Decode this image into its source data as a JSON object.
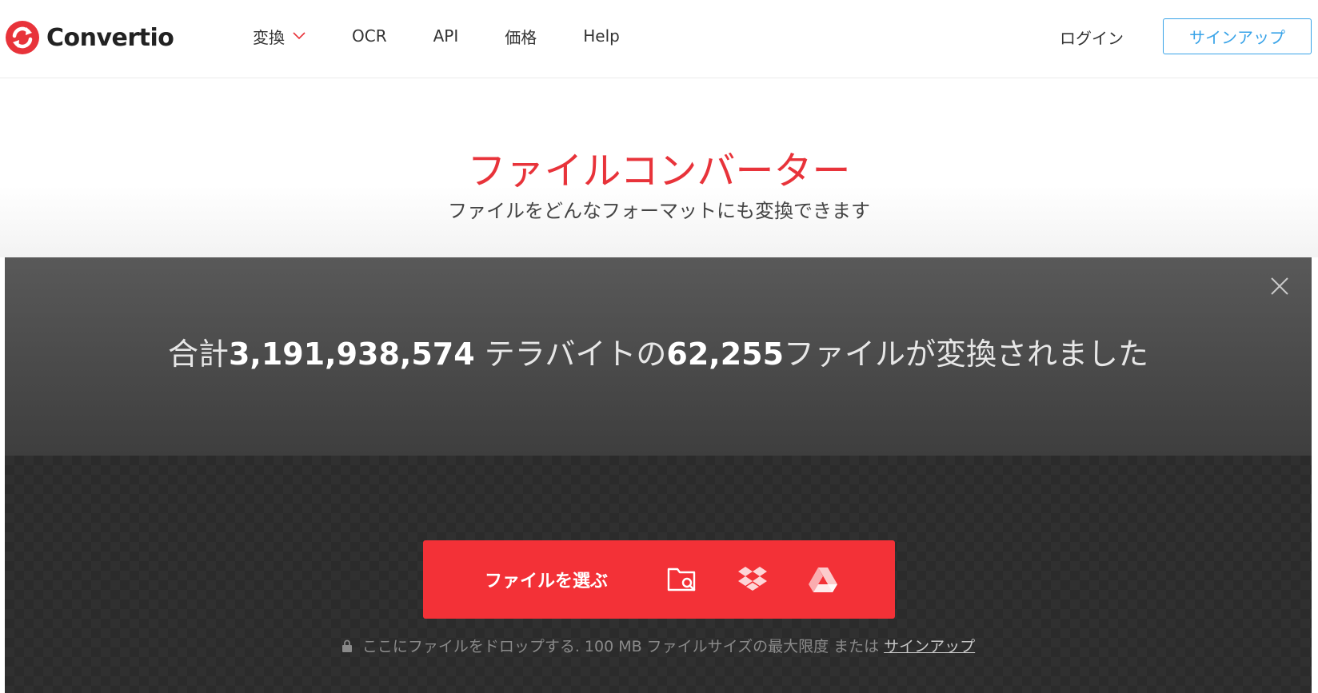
{
  "brand": {
    "name": "Convertio",
    "accent": "#e8333a"
  },
  "nav": {
    "items": [
      {
        "label": "変換",
        "has_dropdown": true
      },
      {
        "label": "OCR"
      },
      {
        "label": "API"
      },
      {
        "label": "価格"
      },
      {
        "label": "Help"
      }
    ],
    "login": "ログイン",
    "signup": "サインアップ"
  },
  "hero": {
    "title": "ファイルコンバーター",
    "subtitle": "ファイルをどんなフォーマットにも変換できます"
  },
  "stats": {
    "prefix": "合計",
    "terabytes": "3,191,938,574",
    "middle": " テラバイトの",
    "files": "62,255",
    "suffix": "ファイルが変換されました"
  },
  "upload": {
    "choose_label": "ファイルを選ぶ",
    "sources": [
      "folder-search-icon",
      "dropbox-icon",
      "google-drive-icon"
    ],
    "drop_note": "ここにファイルをドロップする. 100 MB ファイルサイズの最大限度 または",
    "signup_link": "サインアップ"
  },
  "colors": {
    "signup_border": "#38a3e8",
    "button_red": "#f33137",
    "panel_dark": "#303030"
  }
}
